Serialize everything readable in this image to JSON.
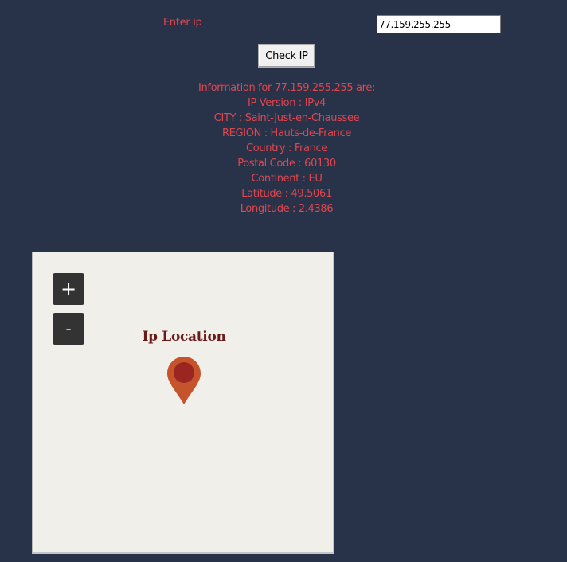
{
  "form": {
    "enter_label": "Enter ip",
    "ip_value": "77.159.255.255",
    "check_button_label": "Check IP"
  },
  "info": {
    "lines": [
      "Information for 77.159.255.255 are:",
      "IP Version : IPv4",
      "CITY : Saint-Just-en-Chaussee",
      "REGION : Hauts-de-France",
      "Country : France",
      "Postal Code : 60130",
      "Continent : EU",
      "Latitude : 49.5061",
      "Longitude : 2.4386"
    ]
  },
  "map": {
    "zoom_in_label": "+",
    "zoom_out_label": "-",
    "marker_label": "Ip Location",
    "marker_icon": "map-pin-icon",
    "colors": {
      "pin_outer": "#c5532b",
      "pin_inner": "#9b2520",
      "label": "#6b1a1a"
    }
  },
  "colors": {
    "background": "#283249",
    "text_accent": "#e0464e"
  }
}
